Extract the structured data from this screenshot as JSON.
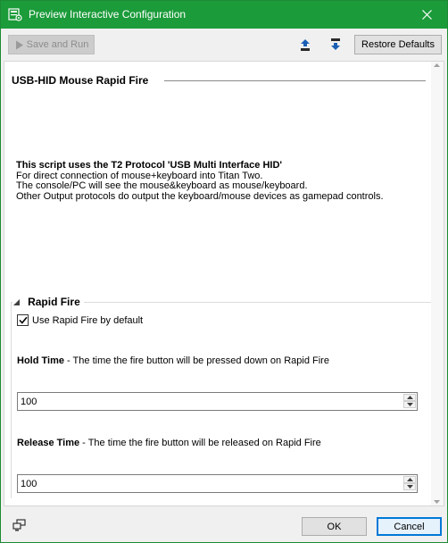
{
  "window": {
    "title": "Preview Interactive Configuration"
  },
  "toolbar": {
    "save_run_label": "Save and Run",
    "restore_label": "Restore Defaults"
  },
  "script": {
    "heading": "USB-HID Mouse Rapid Fire",
    "description_bold": "This script uses the T2 Protocol 'USB Multi Interface HID'",
    "description_lines": [
      "For direct connection of mouse+keyboard into Titan Two.",
      "The console/PC will see the mouse&keyboard as mouse/keyboard.",
      "Other Output protocols do output the keyboard/mouse devices as gamepad controls."
    ]
  },
  "group": {
    "title": "Rapid Fire",
    "checkbox_label": "Use Rapid Fire by default",
    "checkbox_checked": true,
    "hold": {
      "label": "Hold Time",
      "description": " - The time the fire button will be pressed down on Rapid Fire",
      "value": "100"
    },
    "release": {
      "label": "Release Time",
      "description": " - The time the fire button will be released on Rapid Fire",
      "value": "100"
    }
  },
  "footer": {
    "ok_label": "OK",
    "cancel_label": "Cancel"
  },
  "colors": {
    "titlebar": "#1b9b3a",
    "accent": "#0078d7",
    "background": "#f0f0f0"
  },
  "icons": {
    "app": "config-window-icon",
    "close": "close-icon",
    "save_run": "play-icon",
    "upload": "upload-icon",
    "download": "download-icon",
    "collapse": "collapse-triangle-icon",
    "check": "checkmark-icon",
    "spin_up": "spin-up-icon",
    "spin_down": "spin-down-icon",
    "network": "network-icon"
  }
}
